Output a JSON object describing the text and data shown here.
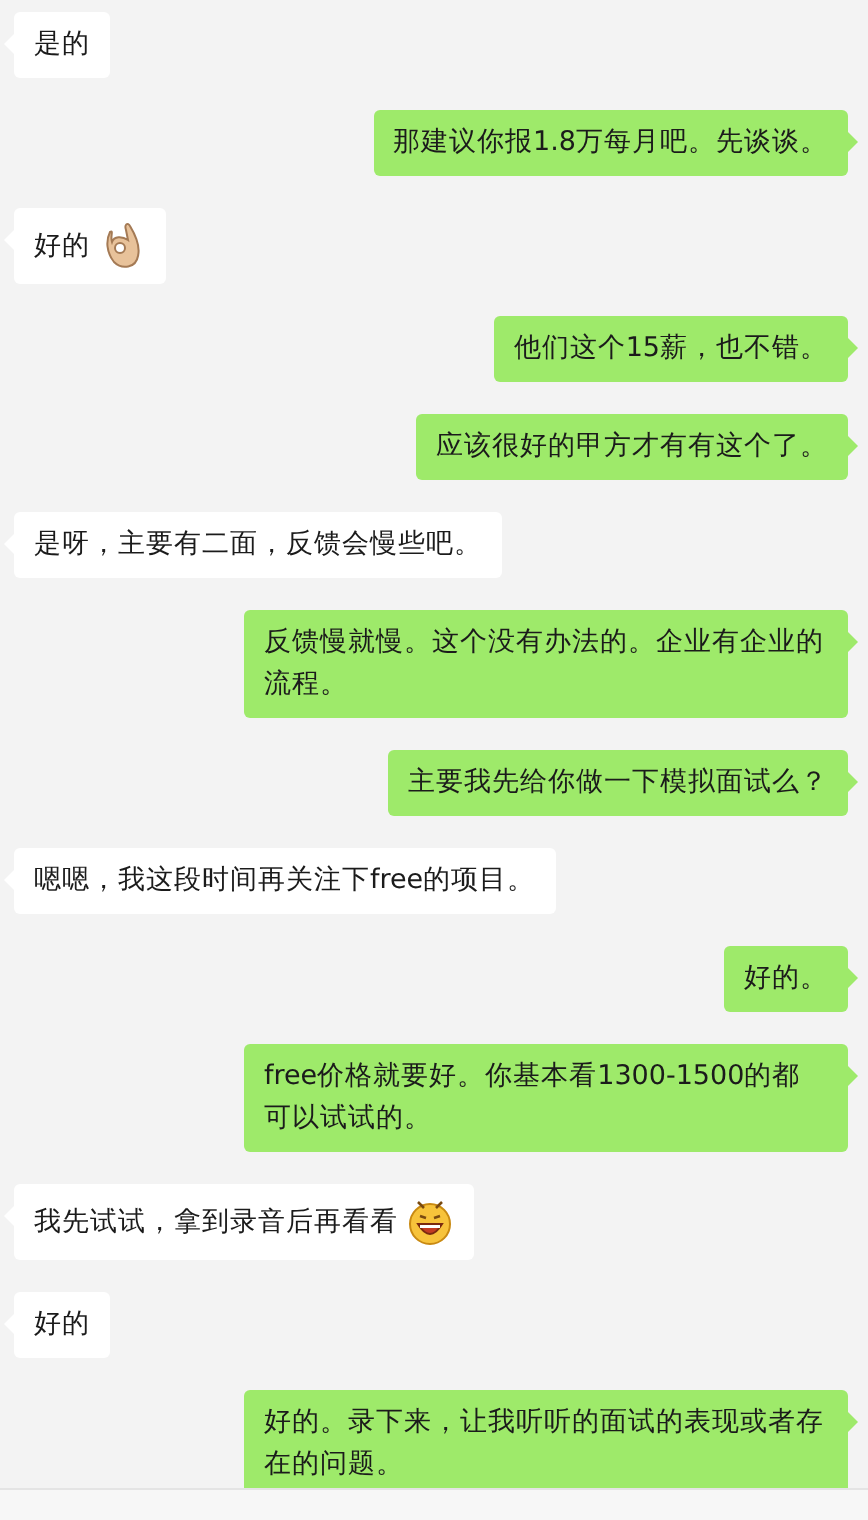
{
  "messages": [
    {
      "kind": "received",
      "text": "是的"
    },
    {
      "kind": "sent",
      "text": "那建议你报1.8万每月吧。先谈谈。"
    },
    {
      "kind": "received",
      "text": "好的",
      "sticker": {
        "kind": "ok"
      }
    },
    {
      "kind": "sent",
      "text": "他们这个15薪，也不错。"
    },
    {
      "kind": "sent",
      "text": "应该很好的甲方才有有这个了。"
    },
    {
      "kind": "received",
      "text": "是呀，主要有二面，反馈会慢些吧。"
    },
    {
      "kind": "sent",
      "text": "反馈慢就慢。这个没有办法的。企业有企业的流程。"
    },
    {
      "kind": "sent",
      "text": "主要我先给你做一下模拟面试么？"
    },
    {
      "kind": "received",
      "text": "嗯嗯，我这段时间再关注下free的项目。"
    },
    {
      "kind": "sent",
      "text": "好的。"
    },
    {
      "kind": "sent",
      "text": "free价格就要好。你基本看1300-1500的都可以试试的。"
    },
    {
      "kind": "received",
      "text": "我先试试，拿到录音后再看看",
      "sticker": {
        "kind": "grin"
      }
    },
    {
      "kind": "received",
      "text": "好的"
    },
    {
      "kind": "sent",
      "text": "好的。录下来，让我听听的面试的表现或者存在的问题。"
    }
  ]
}
